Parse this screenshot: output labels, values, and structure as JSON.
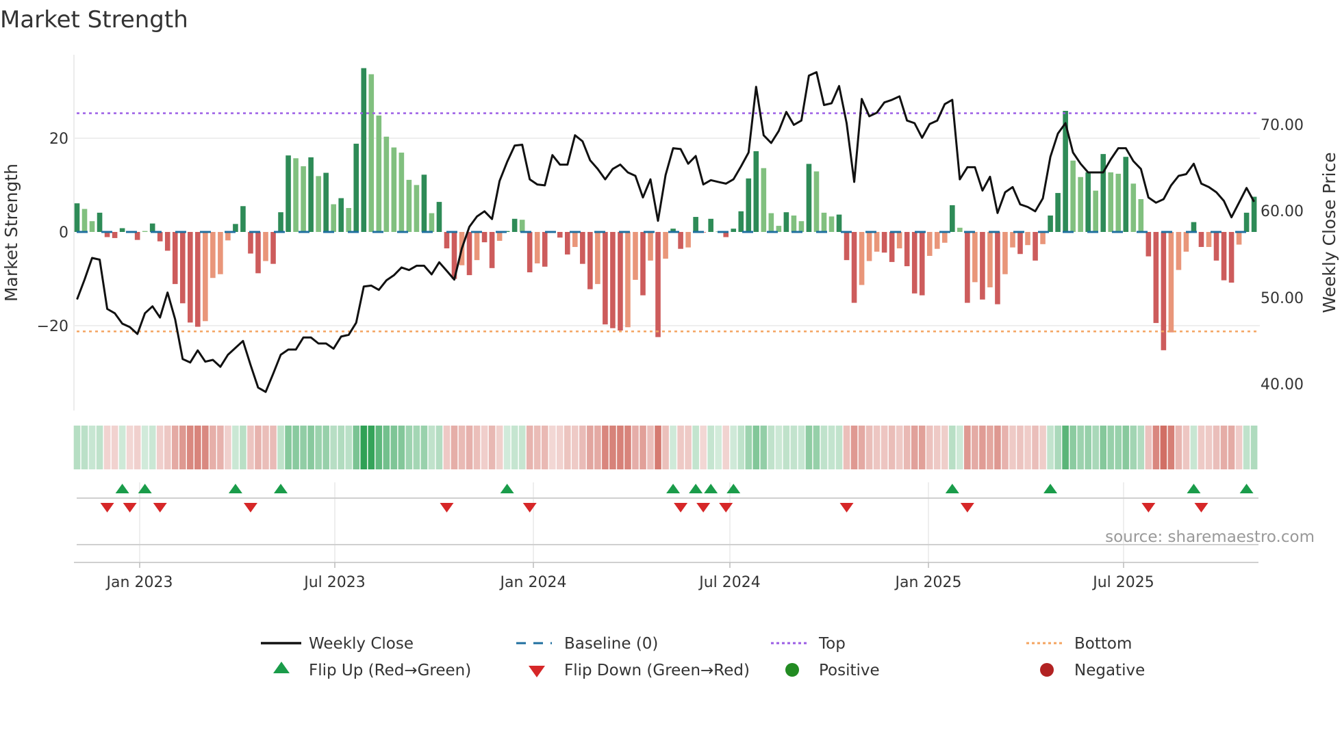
{
  "title": "Market Strength",
  "source": "source: sharemaestro.com",
  "colors": {
    "strong_positive": "#2e8b57",
    "weak_positive": "#81c07f",
    "strong_negative": "#cd5c5c",
    "weak_negative": "#e9967a",
    "line": "#111111",
    "baseline": "#1f6f9f",
    "top": "#9b5de5",
    "bottom": "#f4a460",
    "flip_up": "#1a9c4a",
    "flip_down": "#d62728",
    "positive": "#228b22",
    "negative": "#b22222"
  },
  "legend": {
    "weekly_close": "Weekly Close",
    "baseline": "Baseline (0)",
    "top": "Top",
    "bottom": "Bottom",
    "flip_up": "Flip Up (Red→Green)",
    "flip_down": "Flip Down (Green→Red)",
    "positive": "Positive",
    "negative": "Negative"
  },
  "chart_data": {
    "type": "bar+line",
    "title": "Market Strength",
    "ylabel": "Market Strength",
    "y2label": "Weekly Close Price",
    "ylim": [
      -38,
      40
    ],
    "y2lim": [
      35,
      80
    ],
    "yticks": [
      "20",
      "0",
      "−20"
    ],
    "y2ticks": [
      "70.00",
      "60.00",
      "50.00",
      "40.00"
    ],
    "xticks": [
      "Jan 2023",
      "Jul 2023",
      "Jan 2024",
      "Jul 2024",
      "Jan 2025",
      "Jul 2025"
    ],
    "frequency": "weekly",
    "top_level": 25.3,
    "bottom_level": -21.2,
    "baseline": 0,
    "strength": [
      6.1,
      4.9,
      2.3,
      4.1,
      -1.1,
      -1.3,
      0.8,
      -0.1,
      -1.7,
      0.2,
      1.8,
      -2.0,
      -4.0,
      -11.1,
      -15.2,
      -19.3,
      -20.2,
      -19.0,
      -9.8,
      -9.0,
      -1.8,
      1.7,
      5.5,
      -4.6,
      -8.8,
      -6.2,
      -6.8,
      4.2,
      16.3,
      15.7,
      14.0,
      15.9,
      11.9,
      12.6,
      5.9,
      7.2,
      5.1,
      18.8,
      34.9,
      33.6,
      24.8,
      20.3,
      18.0,
      16.9,
      11.1,
      10.0,
      12.2,
      4.0,
      6.4,
      -3.5,
      -10.0,
      -7.1,
      -9.2,
      -6.0,
      -2.2,
      -7.7,
      -1.9,
      0.2,
      2.8,
      2.6,
      -8.6,
      -6.7,
      -7.4,
      -0.1,
      -1.2,
      -4.8,
      -3.2,
      -6.8,
      -12.2,
      -11.1,
      -19.7,
      -20.5,
      -21.0,
      -20.3,
      -10.2,
      -13.5,
      -6.1,
      -22.4,
      -5.7,
      0.7,
      -3.6,
      -3.3,
      3.2,
      -0.1,
      2.8,
      0.1,
      -1.1,
      0.7,
      4.4,
      11.4,
      17.2,
      13.6,
      4.0,
      1.3,
      4.2,
      3.5,
      2.3,
      14.5,
      12.9,
      4.1,
      3.3,
      3.7,
      -6.0,
      -15.1,
      -11.3,
      -6.2,
      -4.2,
      -4.4,
      -6.4,
      -3.5,
      -7.3,
      -13.1,
      -13.5,
      -5.1,
      -3.6,
      -2.3,
      5.7,
      0.9,
      -15.1,
      -10.7,
      -14.4,
      -11.8,
      -15.4,
      -9.0,
      -3.3,
      -4.7,
      -2.8,
      -6.1,
      -2.6,
      3.5,
      8.3,
      25.8,
      15.2,
      11.7,
      12.7,
      8.8,
      16.6,
      12.7,
      12.4,
      16.0,
      10.3,
      7.0,
      -5.2,
      -19.4,
      -25.2,
      -21.4,
      -8.1,
      -4.2,
      2.1,
      -3.2,
      -3.2,
      -6.1,
      -10.3,
      -10.8,
      -2.7,
      4.1,
      7.5
    ],
    "shade": "GggGRRGRRgGRRRRRROOOOGGRRORGGggGgGgGgGGgggggggGgGRRORORROGGgRORORRORRORRROOROROGROGRGgRGGGGgggGggGgggGRROOORRORRROOOGgROROROOROROGGGggGgGggGggRRROOOGRORRROGG",
    "weekly_close": [
      49.8,
      52.1,
      54.6,
      54.4,
      48.7,
      48.2,
      47.0,
      46.6,
      45.8,
      48.2,
      49.0,
      47.7,
      50.6,
      47.5,
      42.9,
      42.5,
      43.9,
      42.6,
      42.8,
      42.0,
      43.4,
      44.2,
      45.0,
      42.2,
      39.6,
      39.1,
      41.2,
      43.4,
      44.0,
      44.0,
      45.4,
      45.4,
      44.7,
      44.7,
      44.1,
      45.5,
      45.7,
      47.1,
      51.3,
      51.4,
      50.9,
      52.0,
      52.6,
      53.5,
      53.2,
      53.7,
      53.7,
      52.7,
      54.1,
      53.1,
      52.1,
      55.7,
      58.2,
      59.4,
      60.0,
      59.1,
      63.5,
      65.7,
      67.6,
      67.7,
      63.7,
      63.1,
      63.0,
      66.5,
      65.4,
      65.4,
      68.8,
      68.1,
      65.9,
      64.9,
      63.7,
      64.9,
      65.4,
      64.5,
      64.1,
      61.6,
      63.7,
      58.9,
      64.2,
      67.3,
      67.2,
      65.5,
      66.4,
      63.1,
      63.6,
      63.4,
      63.2,
      63.7,
      65.2,
      66.8,
      74.4,
      68.8,
      67.9,
      69.3,
      71.5,
      70.0,
      70.5,
      75.7,
      76.1,
      72.3,
      72.5,
      74.5,
      70.2,
      63.4,
      73.0,
      71.0,
      71.4,
      72.6,
      72.9,
      73.3,
      70.5,
      70.2,
      68.5,
      70.1,
      70.5,
      72.4,
      72.9,
      63.7,
      65.1,
      65.1,
      62.4,
      64.0,
      59.8,
      62.2,
      62.8,
      60.8,
      60.5,
      60.0,
      61.5,
      66.3,
      69.0,
      70.2,
      66.8,
      65.5,
      64.5,
      64.5,
      64.5,
      66.0,
      67.3,
      67.3,
      65.8,
      64.9,
      61.6,
      61.0,
      61.4,
      63.0,
      64.1,
      64.3,
      65.5,
      63.2,
      62.8,
      62.2,
      61.2,
      59.3,
      61.0,
      62.7,
      61.1
    ],
    "flip_up_weeks": [
      6,
      9,
      21,
      27,
      57,
      79,
      82,
      84,
      87,
      116,
      129,
      148,
      155
    ],
    "flip_down_weeks": [
      4,
      7,
      11,
      23,
      49,
      60,
      80,
      83,
      86,
      102,
      118,
      142,
      149
    ]
  }
}
